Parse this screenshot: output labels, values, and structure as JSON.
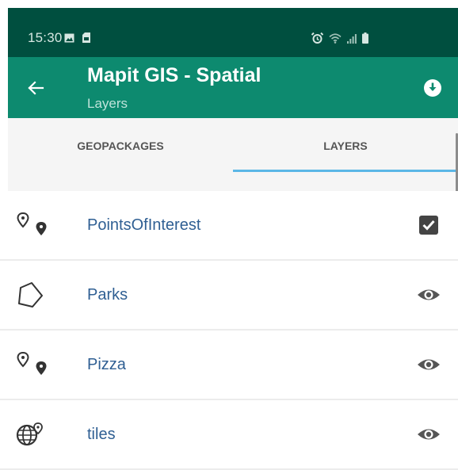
{
  "status_bar": {
    "time": "15:30",
    "left_icons": [
      "image-icon",
      "sim-card-icon"
    ],
    "right_icons": [
      "alarm-icon",
      "wifi-icon",
      "signal-icon",
      "battery-icon"
    ]
  },
  "app_bar": {
    "title": "Mapit GIS - Spatial",
    "subtitle": "Layers",
    "back_icon": "arrow-back-icon",
    "action_icon": "download-icon",
    "color": "#0d8a6f"
  },
  "tabs": [
    {
      "label": "GEOPACKAGES",
      "selected": false
    },
    {
      "label": "LAYERS",
      "selected": true
    }
  ],
  "accent_indicator_color": "#5bb7e6",
  "layers": [
    {
      "name": "PointsOfInterest",
      "type_icon": "map-pins-icon",
      "action_icon": "checkbox-checked-icon"
    },
    {
      "name": "Parks",
      "type_icon": "polygon-icon",
      "action_icon": "eye-icon"
    },
    {
      "name": "Pizza",
      "type_icon": "map-pins-icon",
      "action_icon": "eye-icon"
    },
    {
      "name": "tiles",
      "type_icon": "globe-pin-icon",
      "action_icon": "eye-icon"
    }
  ]
}
